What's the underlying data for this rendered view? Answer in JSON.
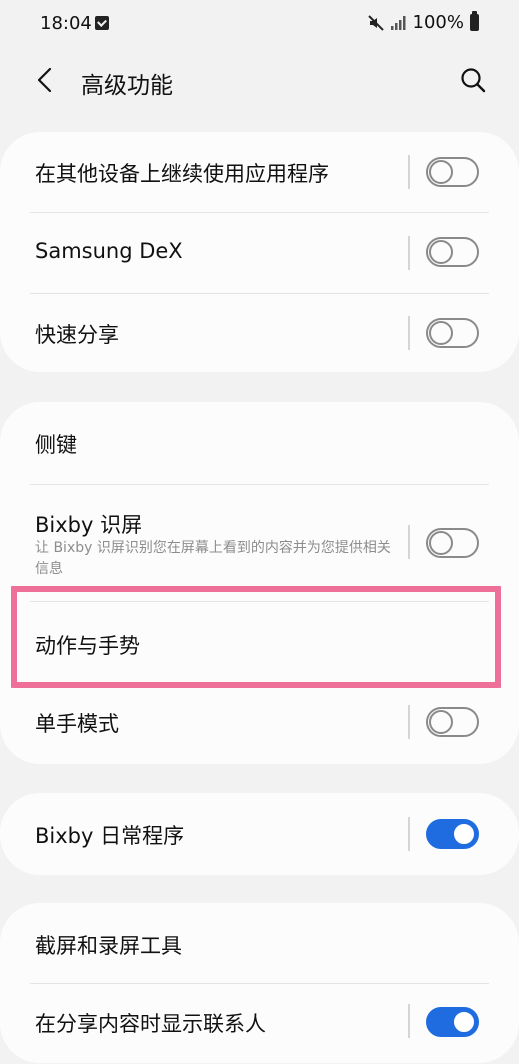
{
  "status_bar": {
    "time": "18:04",
    "notification_icon": "check-box-icon",
    "mute_icon": "muted-speaker-icon",
    "signal_icon": "signal-bars-icon",
    "battery_text": "100%",
    "battery_icon": "battery-icon"
  },
  "header": {
    "back_icon": "chevron-left-icon",
    "title": "高级功能",
    "search_icon": "search-icon"
  },
  "card1": {
    "row1": {
      "title": "在其他设备上继续使用应用程序",
      "toggle": false
    },
    "row2": {
      "title": "Samsung DeX",
      "toggle": false
    },
    "row3": {
      "title": "快速分享",
      "toggle": false
    }
  },
  "card2": {
    "row1": {
      "title": "侧键"
    },
    "row2": {
      "title": "Bixby 识屏",
      "subtitle": "让 Bixby 识屏识别您在屏幕上看到的内容并为您提供相关信息",
      "toggle": false
    },
    "row3": {
      "title": "动作与手势"
    },
    "row4": {
      "title": "单手模式",
      "toggle": false
    }
  },
  "card3": {
    "row1": {
      "title": "Bixby 日常程序",
      "toggle": true
    }
  },
  "card4": {
    "row1": {
      "title": "截屏和录屏工具"
    },
    "row2": {
      "title": "在分享内容时显示联系人",
      "toggle": true
    }
  },
  "colors": {
    "background": "#f2f2f2",
    "card": "#fcfcfc",
    "toggle_on": "#1f6ce0",
    "toggle_off": "#8a8a8a",
    "highlight": "#ee6f97"
  }
}
